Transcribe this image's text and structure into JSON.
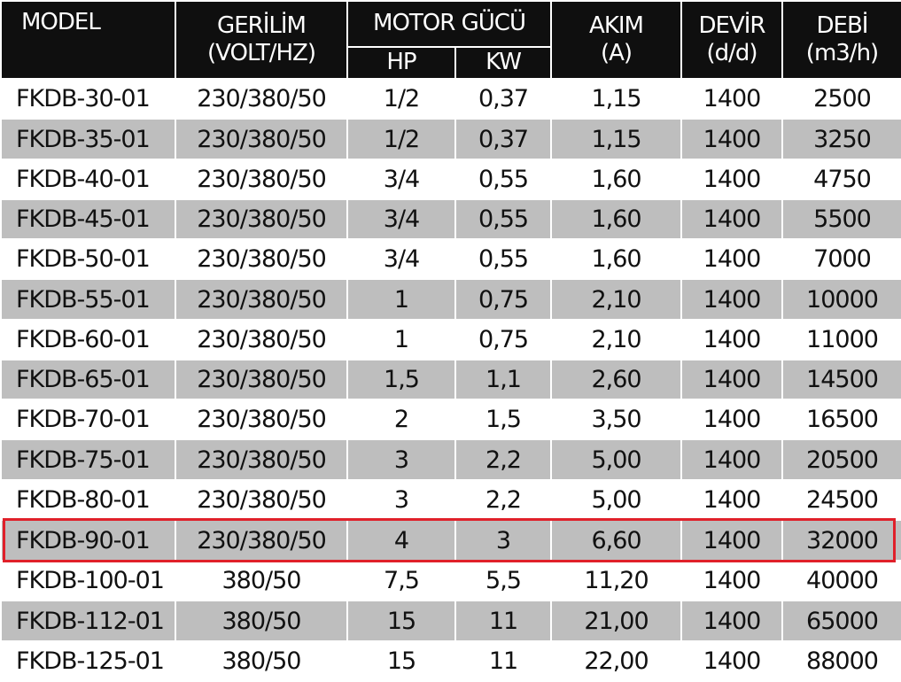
{
  "header": {
    "model": "MODEL",
    "voltage_top": "GERİLİM",
    "voltage_bottom": "(VOLT/HZ)",
    "motor_power": "MOTOR GÜCÜ",
    "hp": "HP",
    "kw": "KW",
    "current_top": "AKIM",
    "current_bottom": "(A)",
    "speed_top": "DEVİR",
    "speed_bottom": "(d/d)",
    "flow_top": "DEBİ",
    "flow_bottom": "(m3/h)"
  },
  "rows": [
    {
      "model": "FKDB-30-01",
      "voltage": "230/380/50",
      "hp": "1/2",
      "kw": "0,37",
      "current": "1,15",
      "speed": "1400",
      "flow": "2500"
    },
    {
      "model": "FKDB-35-01",
      "voltage": "230/380/50",
      "hp": "1/2",
      "kw": "0,37",
      "current": "1,15",
      "speed": "1400",
      "flow": "3250"
    },
    {
      "model": "FKDB-40-01",
      "voltage": "230/380/50",
      "hp": "3/4",
      "kw": "0,55",
      "current": "1,60",
      "speed": "1400",
      "flow": "4750"
    },
    {
      "model": "FKDB-45-01",
      "voltage": "230/380/50",
      "hp": "3/4",
      "kw": "0,55",
      "current": "1,60",
      "speed": "1400",
      "flow": "5500"
    },
    {
      "model": "FKDB-50-01",
      "voltage": "230/380/50",
      "hp": "3/4",
      "kw": "0,55",
      "current": "1,60",
      "speed": "1400",
      "flow": "7000"
    },
    {
      "model": "FKDB-55-01",
      "voltage": "230/380/50",
      "hp": "1",
      "kw": "0,75",
      "current": "2,10",
      "speed": "1400",
      "flow": "10000"
    },
    {
      "model": "FKDB-60-01",
      "voltage": "230/380/50",
      "hp": "1",
      "kw": "0,75",
      "current": "2,10",
      "speed": "1400",
      "flow": "11000"
    },
    {
      "model": "FKDB-65-01",
      "voltage": "230/380/50",
      "hp": "1,5",
      "kw": "1,1",
      "current": "2,60",
      "speed": "1400",
      "flow": "14500"
    },
    {
      "model": "FKDB-70-01",
      "voltage": "230/380/50",
      "hp": "2",
      "kw": "1,5",
      "current": "3,50",
      "speed": "1400",
      "flow": "16500"
    },
    {
      "model": "FKDB-75-01",
      "voltage": "230/380/50",
      "hp": "3",
      "kw": "2,2",
      "current": "5,00",
      "speed": "1400",
      "flow": "20500"
    },
    {
      "model": "FKDB-80-01",
      "voltage": "230/380/50",
      "hp": "3",
      "kw": "2,2",
      "current": "5,00",
      "speed": "1400",
      "flow": "24500"
    },
    {
      "model": "FKDB-90-01",
      "voltage": "230/380/50",
      "hp": "4",
      "kw": "3",
      "current": "6,60",
      "speed": "1400",
      "flow": "32000"
    },
    {
      "model": "FKDB-100-01",
      "voltage": "380/50",
      "hp": "7,5",
      "kw": "5,5",
      "current": "11,20",
      "speed": "1400",
      "flow": "40000"
    },
    {
      "model": "FKDB-112-01",
      "voltage": "380/50",
      "hp": "15",
      "kw": "11",
      "current": "21,00",
      "speed": "1400",
      "flow": "65000"
    },
    {
      "model": "FKDB-125-01",
      "voltage": "380/50",
      "hp": "15",
      "kw": "11",
      "current": "22,00",
      "speed": "1400",
      "flow": "88000"
    }
  ],
  "highlighted_model": "FKDB-90-01",
  "colors": {
    "header_bg": "#0f0f0f",
    "header_text": "#ffffff",
    "stripe": "#bebebe",
    "highlight_border": "#e0202a"
  }
}
